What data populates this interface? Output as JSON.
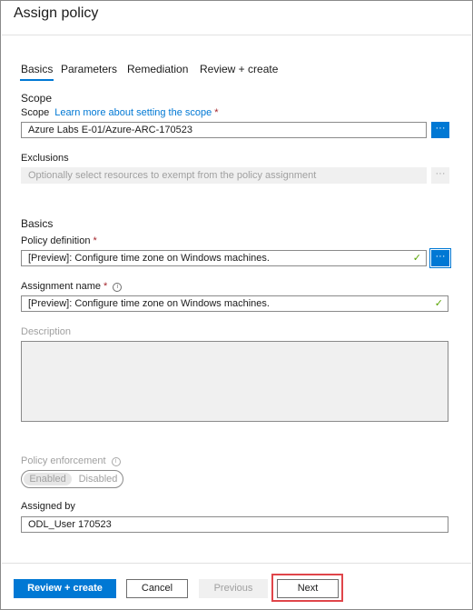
{
  "panel": {
    "title": "Assign policy"
  },
  "tabs": [
    {
      "label": "Basics",
      "active": true
    },
    {
      "label": "Parameters",
      "active": false
    },
    {
      "label": "Remediation",
      "active": false
    },
    {
      "label": "Review + create",
      "active": false
    }
  ],
  "scope": {
    "section_title": "Scope",
    "label": "Scope",
    "link": "Learn more about setting the scope",
    "required_mark": "*",
    "value": "Azure Labs E-01/Azure-ARC-170523",
    "button_label": "···"
  },
  "exclusions": {
    "label": "Exclusions",
    "placeholder": "Optionally select resources to exempt from the policy assignment",
    "button_label": "···"
  },
  "basics": {
    "section_title": "Basics",
    "policy_definition": {
      "label": "Policy definition",
      "required_mark": "*",
      "value": "[Preview]: Configure time zone on Windows machines.",
      "button_label": "···",
      "valid_icon": "✓"
    },
    "assignment_name": {
      "label": "Assignment name",
      "required_mark": "*",
      "info_icon": "i",
      "value": "[Preview]: Configure time zone on Windows machines.",
      "valid_icon": "✓"
    },
    "description": {
      "label": "Description"
    },
    "policy_enforcement": {
      "label": "Policy enforcement",
      "info_icon": "i",
      "options": [
        "Enabled",
        "Disabled"
      ],
      "selected": "Enabled"
    },
    "assigned_by": {
      "label": "Assigned by",
      "value": "ODL_User 170523"
    }
  },
  "footer": {
    "review_create": "Review + create",
    "cancel": "Cancel",
    "previous": "Previous",
    "next": "Next"
  },
  "colors": {
    "accent": "#0078d4",
    "required": "#a4262c",
    "valid": "#57a300",
    "highlight": "#e0454a"
  }
}
